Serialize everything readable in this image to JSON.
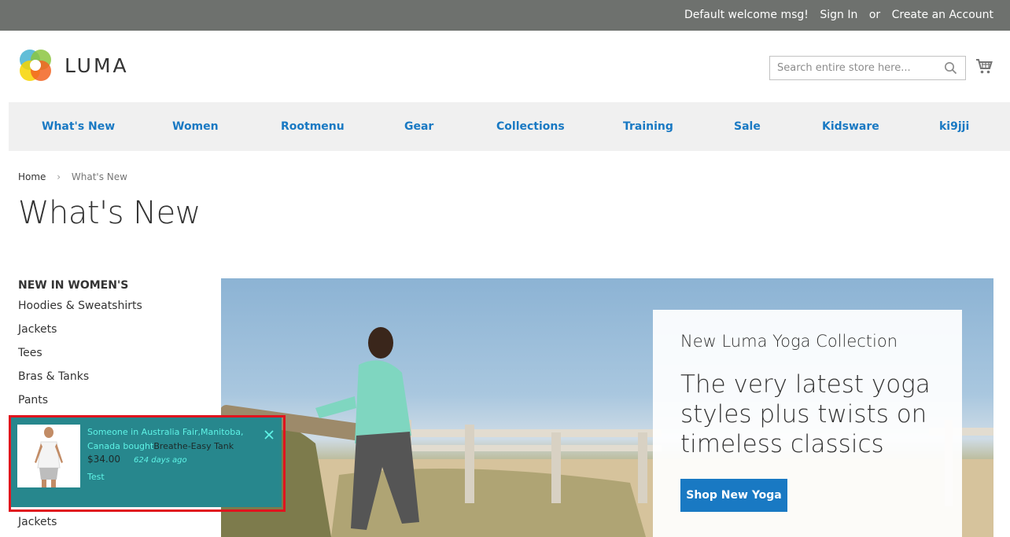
{
  "header": {
    "welcome": "Default welcome msg!",
    "sign_in": "Sign In",
    "or": "or",
    "create_account": "Create an Account",
    "logo_text": "LUMA"
  },
  "search": {
    "placeholder": "Search entire store here..."
  },
  "nav": {
    "items": [
      "What's New",
      "Women",
      "Rootmenu",
      "Gear",
      "Collections",
      "Training",
      "Sale",
      "Kidsware",
      "ki9jji"
    ]
  },
  "breadcrumb": {
    "home": "Home",
    "separator": "›",
    "current": "What's New"
  },
  "page": {
    "title": "What's New"
  },
  "sidebar": {
    "heading": "NEW IN WOMEN'S",
    "links": [
      "Hoodies & Sweatshirts",
      "Jackets",
      "Tees",
      "Bras & Tanks",
      "Pants"
    ],
    "bottom_link": "Jackets"
  },
  "hero": {
    "kicker": "New Luma Yoga Collection",
    "headline": "The very latest yoga styles plus twists on timeless classics",
    "cta": "Shop New Yoga"
  },
  "popup": {
    "message": "Someone in Australia Fair,Manitoba, Canada bought",
    "product": "Breathe-Easy Tank",
    "price": "$34.00",
    "time_ago": "624 days ago",
    "extra": "Test"
  },
  "colors": {
    "topbar": "#6e716e",
    "link": "#1979c3",
    "popup_bg": "#27878d",
    "highlight": "#e0141e"
  }
}
